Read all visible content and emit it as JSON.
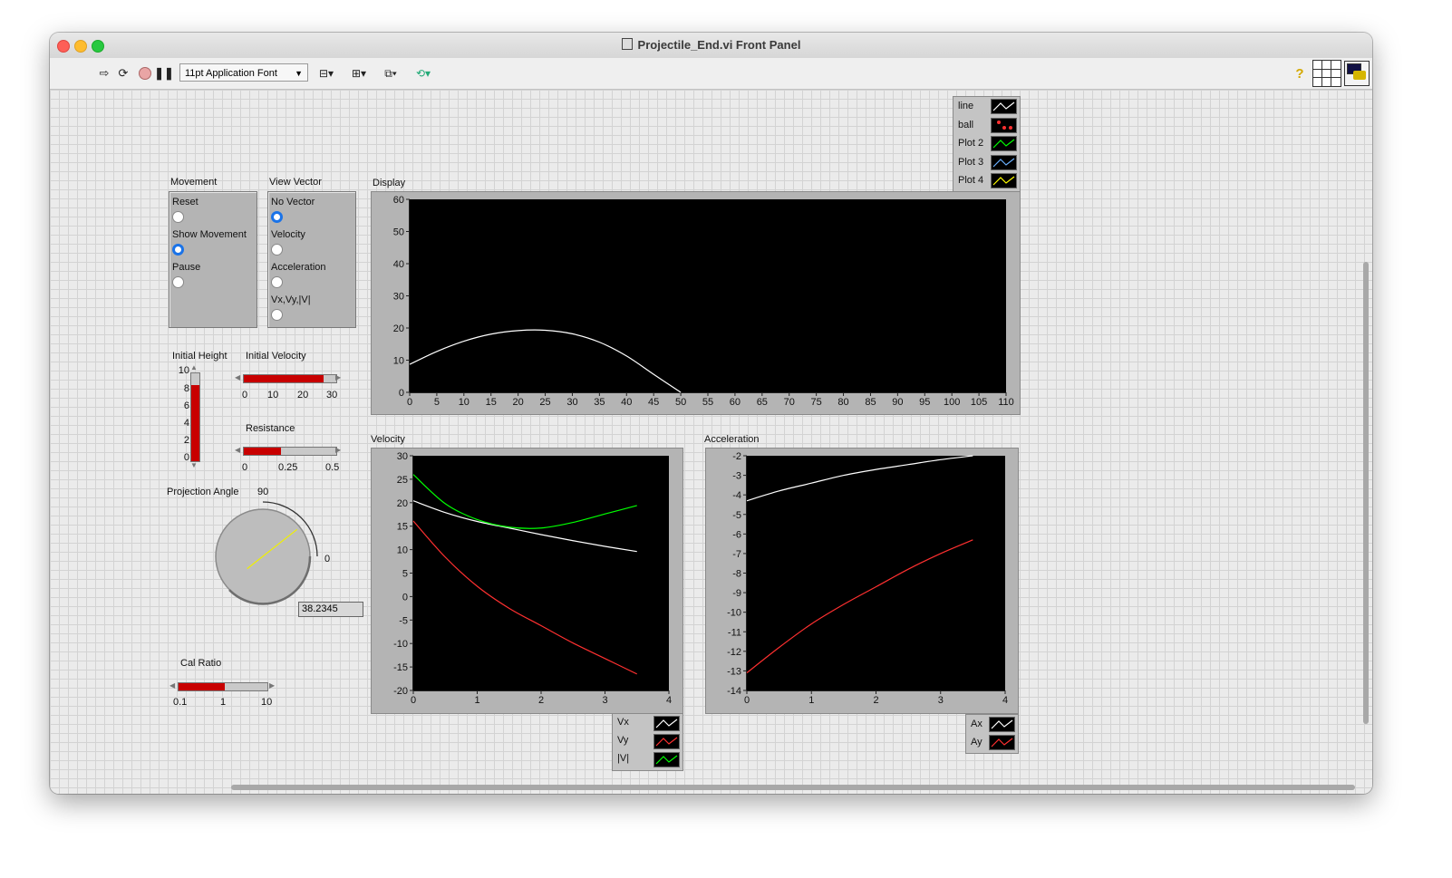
{
  "window": {
    "title": "Projectile_End.vi Front Panel"
  },
  "toolbar": {
    "font_select": "11pt Application Font",
    "help_icon": "?"
  },
  "movement": {
    "title": "Movement",
    "options": [
      "Reset",
      "Show Movement",
      "Pause"
    ],
    "selected": 1
  },
  "view_vector": {
    "title": "View Vector",
    "options": [
      "No Vector",
      "Velocity",
      "Acceleration",
      "Vx,Vy,|V|"
    ],
    "selected": 0
  },
  "initial_height": {
    "label": "Initial Height",
    "ticks": [
      "10",
      "8",
      "6",
      "4",
      "2",
      "0"
    ],
    "value": 8.7,
    "max": 10
  },
  "initial_velocity": {
    "label": "Initial Velocity",
    "ticks": [
      "0",
      "10",
      "20",
      "30"
    ],
    "value": 26,
    "max": 30
  },
  "resistance": {
    "label": "Resistance",
    "ticks": [
      "0",
      "0.25",
      "0.5"
    ],
    "value": 0.2,
    "max": 0.5
  },
  "projection_angle": {
    "label": "Projection Angle",
    "tick_max": "90",
    "tick_min": "0",
    "value": "38.2345"
  },
  "cal_ratio": {
    "label": "Cal Ratio",
    "ticks": [
      "0.1",
      "1",
      "10"
    ],
    "value_fraction": 0.52
  },
  "display_legend": [
    {
      "name": "line",
      "color": "#ffffff"
    },
    {
      "name": "ball",
      "color": "#ff3030"
    },
    {
      "name": "Plot 2",
      "color": "#00ff00"
    },
    {
      "name": "Plot 3",
      "color": "#6ab0ff"
    },
    {
      "name": "Plot 4",
      "color": "#ffff00"
    }
  ],
  "velocity_legend": [
    {
      "name": "Vx",
      "color": "#ffffff"
    },
    {
      "name": "Vy",
      "color": "#ff3030"
    },
    {
      "name": "|V|",
      "color": "#00ff00"
    }
  ],
  "acceleration_legend": [
    {
      "name": "Ax",
      "color": "#ffffff"
    },
    {
      "name": "Ay",
      "color": "#ff3030"
    }
  ],
  "chart_data": [
    {
      "type": "line",
      "title": "Display",
      "xlim": [
        0,
        110
      ],
      "ylim": [
        0,
        60
      ],
      "xticks": [
        0,
        5,
        10,
        15,
        20,
        25,
        30,
        35,
        40,
        45,
        50,
        55,
        60,
        65,
        70,
        75,
        80,
        85,
        90,
        95,
        100,
        105,
        110
      ],
      "yticks": [
        0,
        10,
        20,
        30,
        40,
        50,
        60
      ],
      "series": [
        {
          "name": "line",
          "color": "#ffffff",
          "x": [
            0,
            5,
            10,
            15,
            20,
            25,
            30,
            35,
            40,
            45,
            50
          ],
          "y": [
            8.7,
            12.7,
            15.9,
            18.1,
            19.2,
            19.3,
            18.2,
            15.6,
            11.3,
            5.6,
            0
          ]
        }
      ]
    },
    {
      "type": "line",
      "title": "Velocity",
      "xlim": [
        0,
        4
      ],
      "ylim": [
        -20,
        30
      ],
      "xticks": [
        0,
        1,
        2,
        3,
        4
      ],
      "yticks": [
        30,
        25,
        20,
        15,
        10,
        5,
        0,
        -5,
        -10,
        -15,
        -20
      ],
      "series": [
        {
          "name": "Vx",
          "color": "#ffffff",
          "x": [
            0,
            0.5,
            1,
            1.5,
            2,
            2.5,
            3,
            3.5
          ],
          "y": [
            20.4,
            17.9,
            16.0,
            14.6,
            13.2,
            11.9,
            10.7,
            9.6
          ]
        },
        {
          "name": "Vy",
          "color": "#ff3030",
          "x": [
            0,
            0.5,
            1,
            1.5,
            2,
            2.5,
            3,
            3.5
          ],
          "y": [
            16.1,
            8.4,
            2.2,
            -2.5,
            -6.2,
            -9.9,
            -13.2,
            -16.5
          ]
        },
        {
          "name": "|V|",
          "color": "#00ff00",
          "x": [
            0,
            0.5,
            1,
            1.5,
            2,
            2.5,
            3,
            3.5
          ],
          "y": [
            26,
            19.8,
            16.4,
            14.8,
            14.6,
            15.8,
            17.6,
            19.4
          ]
        }
      ]
    },
    {
      "type": "line",
      "title": "Acceleration",
      "xlim": [
        0,
        4
      ],
      "ylim": [
        -14,
        -2
      ],
      "xticks": [
        0,
        1,
        2,
        3,
        4
      ],
      "yticks": [
        -2,
        -3,
        -4,
        -5,
        -6,
        -7,
        -8,
        -9,
        -10,
        -11,
        -12,
        -13,
        -14
      ],
      "series": [
        {
          "name": "Ax",
          "color": "#ffffff",
          "x": [
            0,
            0.5,
            1,
            1.5,
            2,
            2.5,
            3,
            3.5
          ],
          "y": [
            -4.3,
            -3.8,
            -3.4,
            -3.0,
            -2.7,
            -2.45,
            -2.2,
            -2.0
          ]
        },
        {
          "name": "Ay",
          "color": "#ff3030",
          "x": [
            0,
            0.5,
            1,
            1.5,
            2,
            2.5,
            3,
            3.5
          ],
          "y": [
            -13.1,
            -11.8,
            -10.6,
            -9.6,
            -8.7,
            -7.8,
            -7.0,
            -6.3
          ]
        }
      ]
    }
  ]
}
